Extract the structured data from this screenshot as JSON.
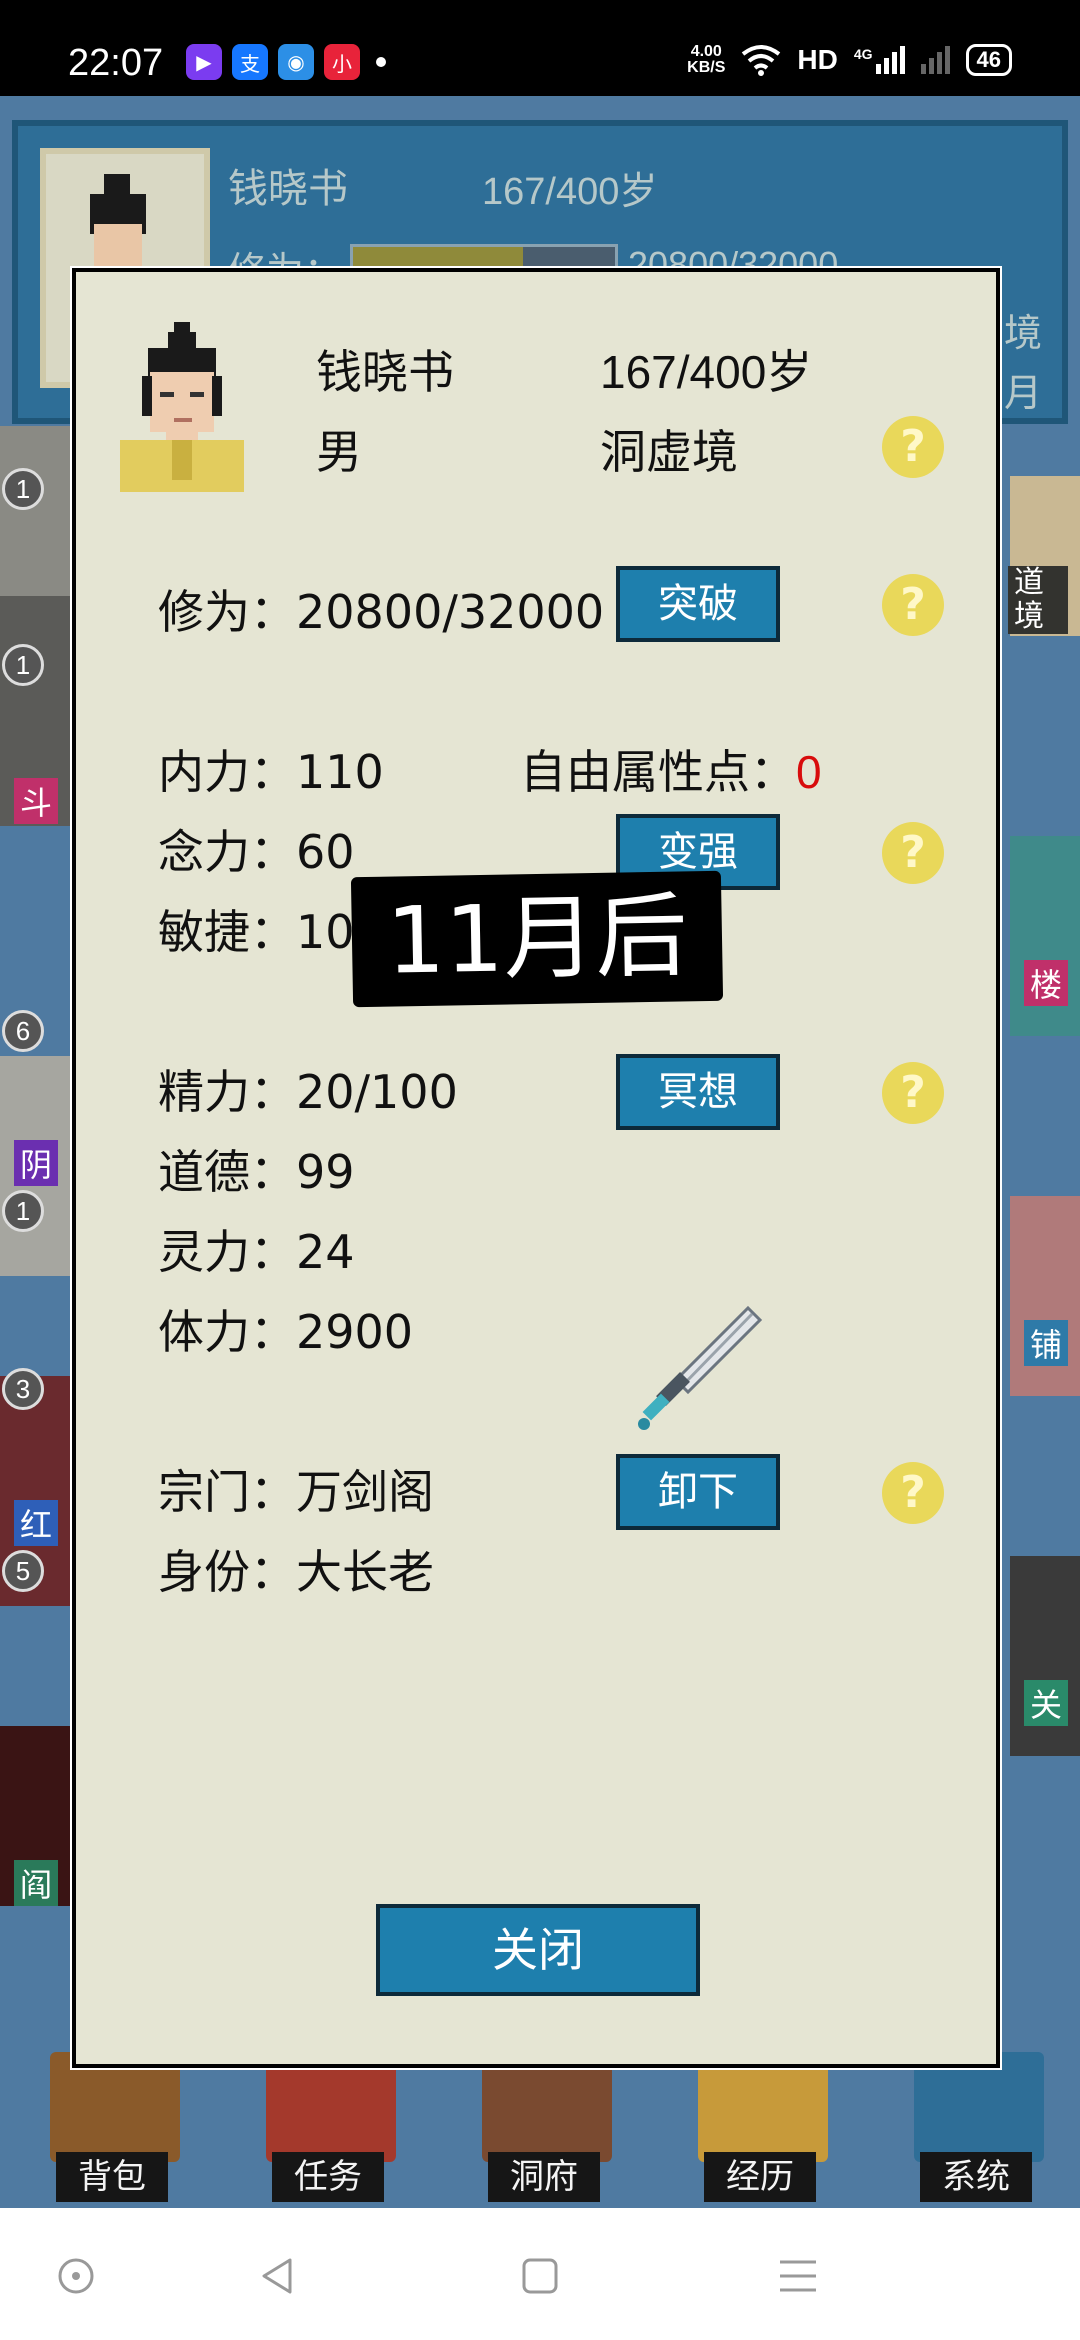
{
  "status_bar": {
    "time": "22:07",
    "apps": [
      "play-app",
      "alipay-app",
      "browser-app",
      "xiaohongshu-app"
    ],
    "app_glyphs": [
      "▶",
      "支",
      "◉",
      "小"
    ],
    "speed_value": "4.00",
    "speed_unit": "KB/S",
    "hd_label": "HD",
    "network_label": "4G",
    "battery": "46"
  },
  "background": {
    "name": "钱晓书",
    "age": "167/400岁",
    "xiuwei_label": "修为：",
    "xiuwei_value": "20800/32000",
    "xiuwei_fraction": 0.65,
    "edge_texts": [
      "境",
      "月"
    ],
    "left_badges": [
      "1",
      "1",
      "6",
      "1",
      "3",
      "5"
    ],
    "left_labels": [
      "斗",
      "阴",
      "红",
      "阎"
    ],
    "right_labels": [
      "道境",
      "楼",
      "铺",
      "关"
    ],
    "dock": [
      "背包",
      "任务",
      "洞府",
      "经历",
      "系统"
    ]
  },
  "dialog": {
    "name": "钱晓书",
    "age": "167/400岁",
    "gender": "男",
    "realm": "洞虚境",
    "xiuwei": "修为：20800/32000",
    "breakthrough_button": "突破",
    "neili": "内力：110",
    "free_points_label": "自由属性点：",
    "free_points_value": "0",
    "nianli": "念力：60",
    "strengthen_button": "变强",
    "minjie": "敏捷：10",
    "jingli": "精力：20/100",
    "meditate_button": "冥想",
    "daode": "道德：99",
    "lingli": "灵力：24",
    "tili": "体力：2900",
    "sect": "宗门：万剑阁",
    "unequip_button": "卸下",
    "identity": "身份：大长老",
    "help_glyph": "?",
    "close_button": "关闭"
  },
  "toast": {
    "text": "11月后"
  },
  "colors": {
    "dialog_bg": "#e5e5d3",
    "button_blue": "#1e7fad",
    "help_yellow": "#e9d85a",
    "highlight_red": "#d80c0c"
  }
}
